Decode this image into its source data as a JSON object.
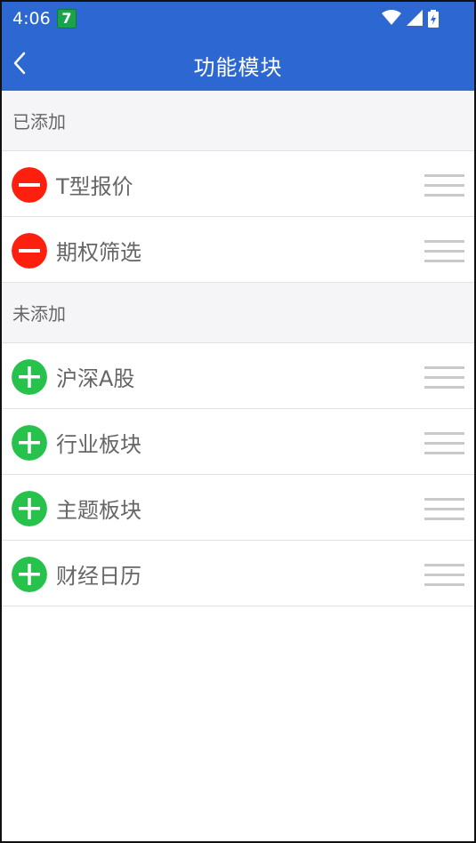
{
  "status": {
    "time": "4:06",
    "notification_badge": "7"
  },
  "header": {
    "title": "功能模块"
  },
  "added": {
    "heading": "已添加",
    "items": [
      {
        "label": "T型报价"
      },
      {
        "label": "期权筛选"
      }
    ]
  },
  "not_added": {
    "heading": "未添加",
    "items": [
      {
        "label": "沪深A股"
      },
      {
        "label": "行业板块"
      },
      {
        "label": "主题板块"
      },
      {
        "label": "财经日历"
      }
    ]
  },
  "colors": {
    "accent": "#2d67d1",
    "remove": "#ff1f0f",
    "add": "#27c24c"
  },
  "icons": {
    "remove": "minus-circle-icon",
    "add": "plus-circle-icon",
    "drag": "drag-handle-icon"
  }
}
